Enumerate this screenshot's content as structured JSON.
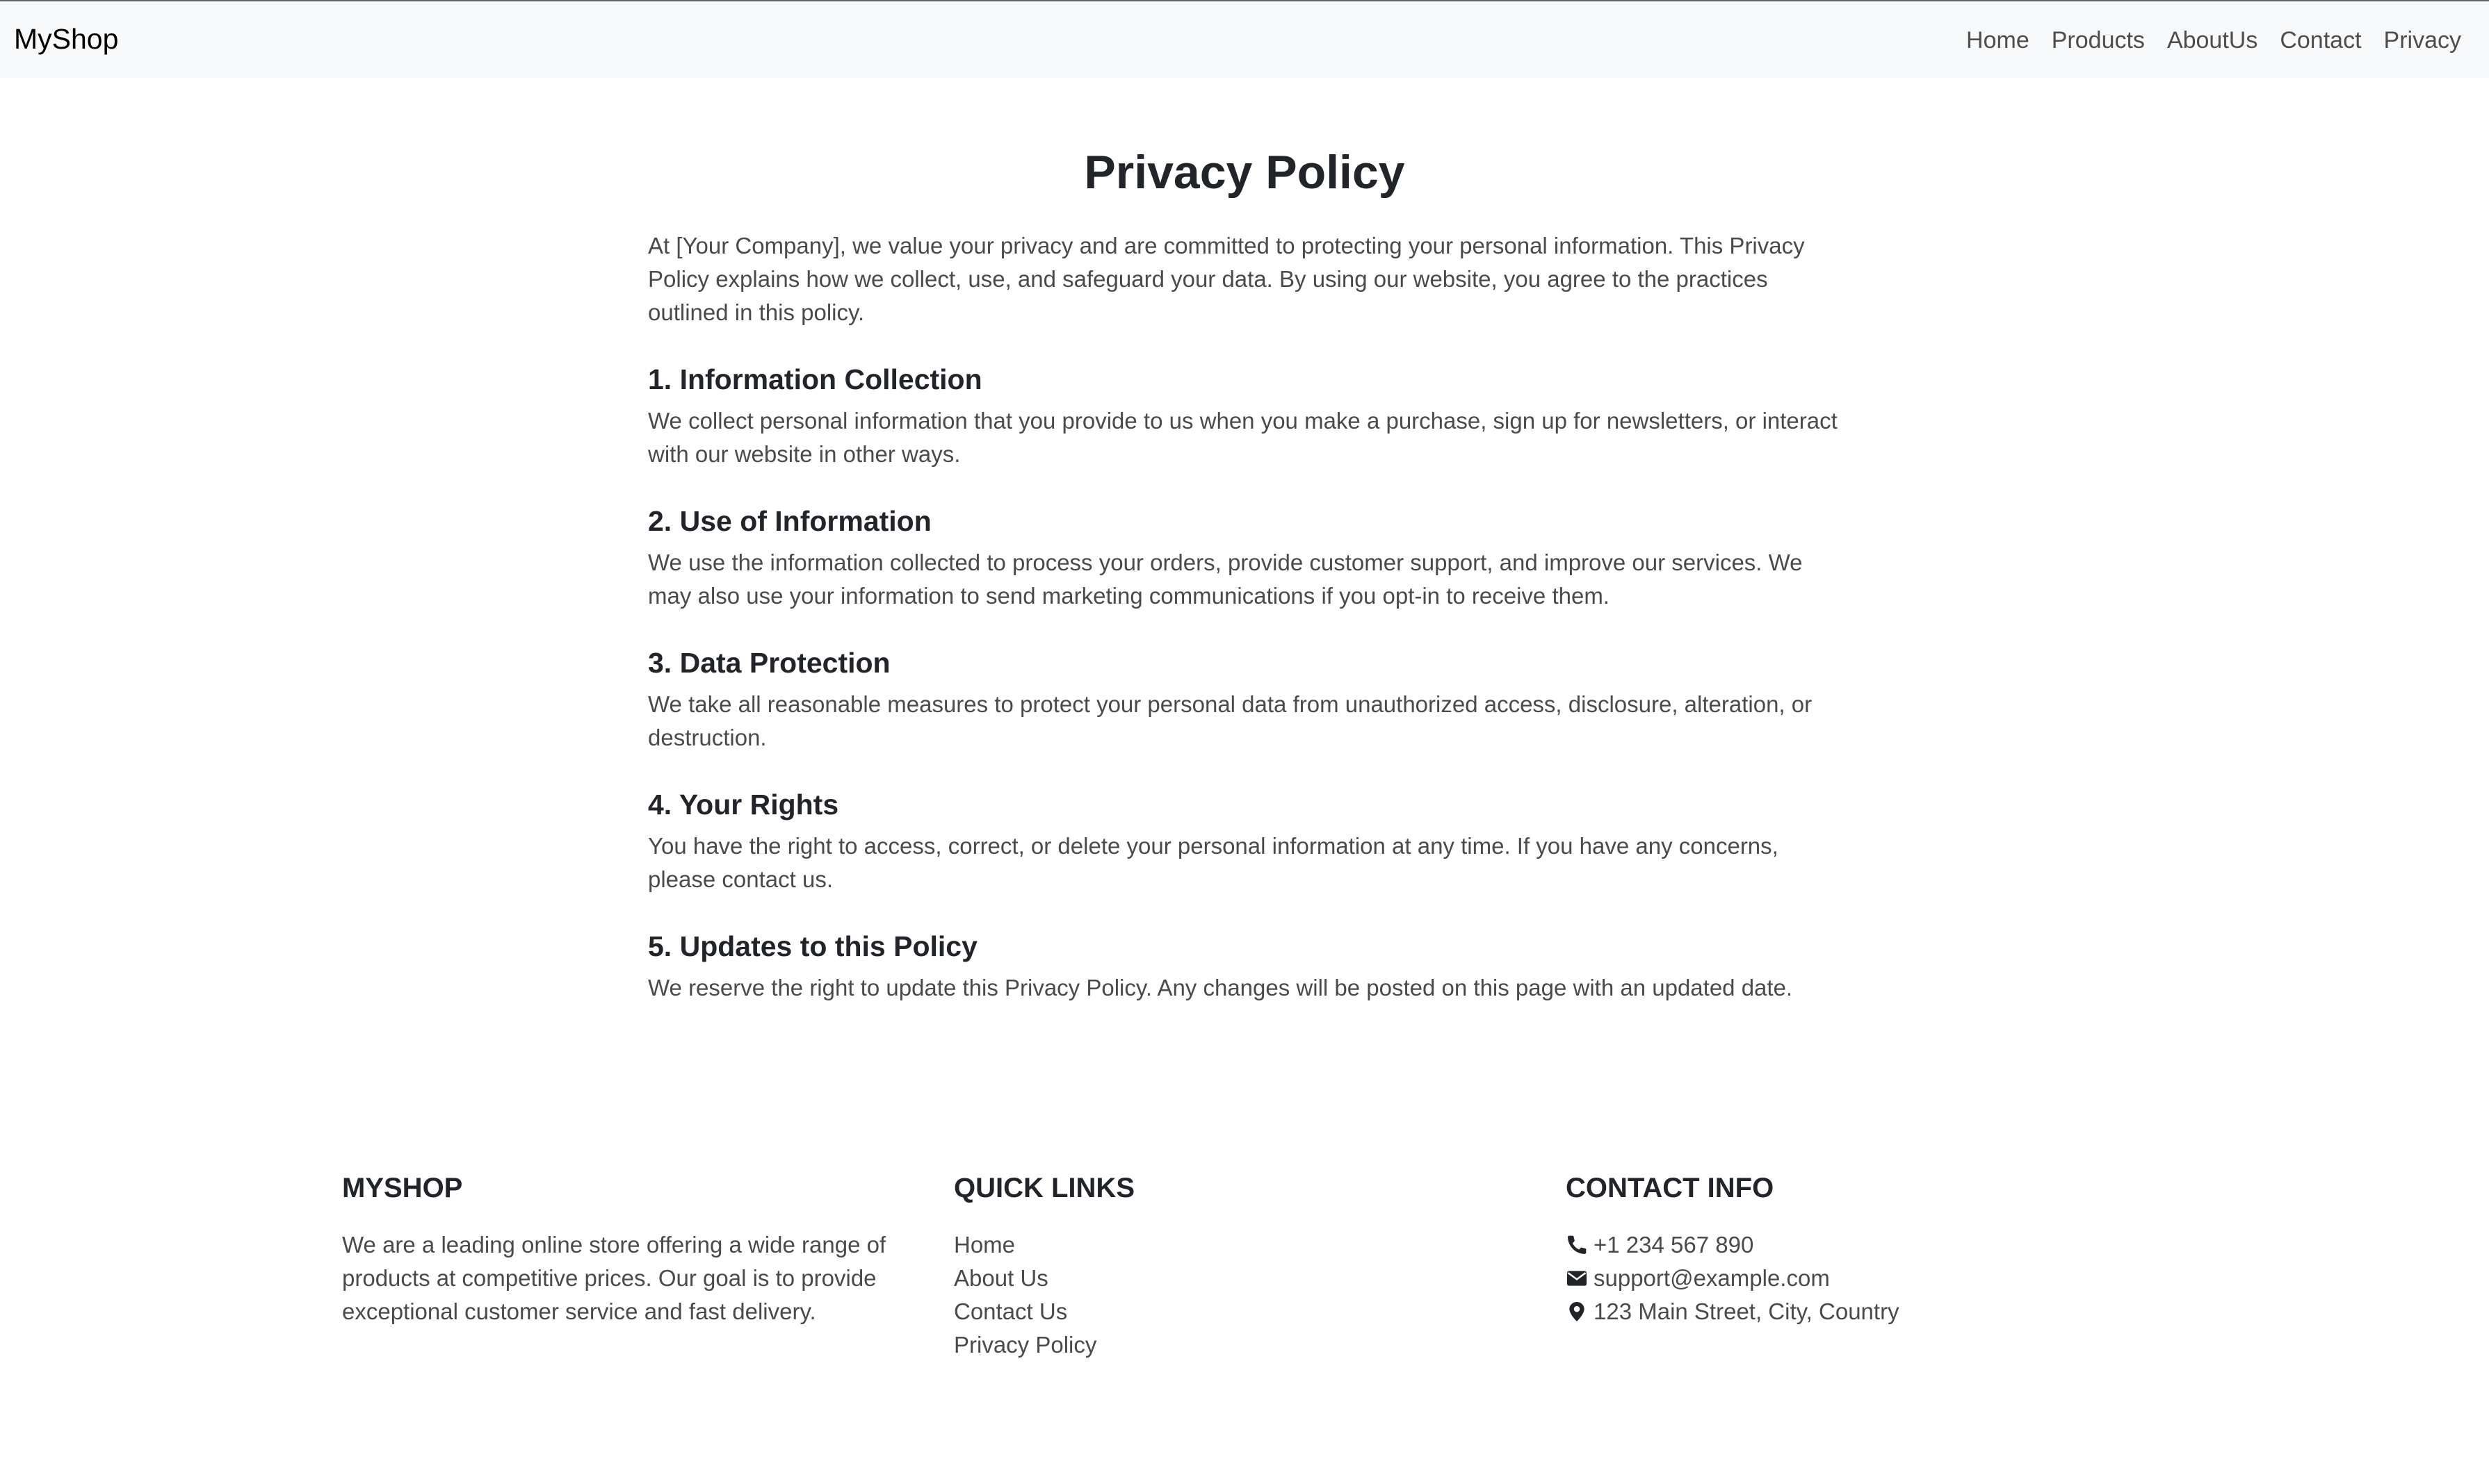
{
  "navbar": {
    "brand": "MyShop",
    "links": [
      "Home",
      "Products",
      "AboutUs",
      "Contact",
      "Privacy"
    ]
  },
  "main": {
    "title": "Privacy Policy",
    "intro": "At [Your Company], we value your privacy and are committed to protecting your personal information. This Privacy Policy explains how we collect, use, and safeguard your data. By using our website, you agree to the practices outlined in this policy.",
    "sections": [
      {
        "heading": "1. Information Collection",
        "text": "We collect personal information that you provide to us when you make a purchase, sign up for newsletters, or interact with our website in other ways."
      },
      {
        "heading": "2. Use of Information",
        "text": "We use the information collected to process your orders, provide customer support, and improve our services. We may also use your information to send marketing communications if you opt-in to receive them."
      },
      {
        "heading": "3. Data Protection",
        "text": "We take all reasonable measures to protect your personal data from unauthorized access, disclosure, alteration, or destruction."
      },
      {
        "heading": "4. Your Rights",
        "text": "You have the right to access, correct, or delete your personal information at any time. If you have any concerns, please contact us."
      },
      {
        "heading": "5. Updates to this Policy",
        "text": "We reserve the right to update this Privacy Policy. Any changes will be posted on this page with an updated date."
      }
    ]
  },
  "footer": {
    "about": {
      "heading": "MYSHOP",
      "text": "We are a leading online store offering a wide range of products at competitive prices. Our goal is to provide exceptional customer service and fast delivery."
    },
    "quick_links": {
      "heading": "QUICK LINKS",
      "links": [
        "Home",
        "About Us",
        "Contact Us",
        "Privacy Policy"
      ]
    },
    "contact": {
      "heading": "CONTACT INFO",
      "phone": "+1 234 567 890",
      "email": "support@example.com",
      "address": "123 Main Street, City, Country",
      "icons": [
        "phone-icon",
        "envelope-icon",
        "map-marker-icon"
      ]
    }
  },
  "colors": {
    "navbar_bg": "#f8f9fa",
    "heading": "#212529",
    "body_text": "#4a4a4a",
    "nav_link": "#4d4d4d"
  }
}
